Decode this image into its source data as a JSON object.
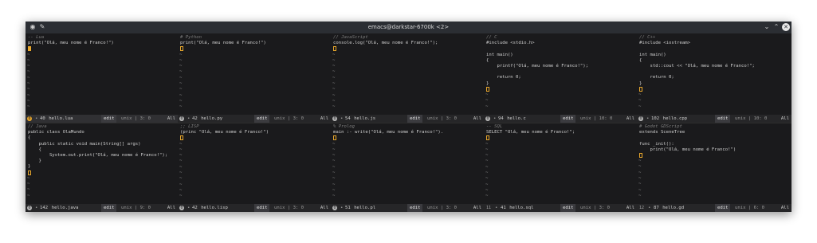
{
  "window": {
    "title": "emacs@darkstar-6700k <2>",
    "app_icon": "emacs-icon",
    "pin_icon": "pin-icon",
    "controls": {
      "minimize": "⌄",
      "maximize": "⌃",
      "close": "✕"
    }
  },
  "accent_color": "#e8a72c",
  "panes": [
    {
      "lines": [
        "-- Lua",
        "print(\"Olá, meu nome é Franco!\")"
      ],
      "modeline": {
        "win": "0",
        "dot": "•",
        "size": "40",
        "buffer": "hello.lua",
        "mode": "edit",
        "enc": "unix | 3: 0",
        "pos": "All"
      }
    },
    {
      "lines": [
        "# Python",
        "print(\"Olá, meu nome é Franco!\")"
      ],
      "modeline": {
        "win": "0",
        "dot": "•",
        "size": "42",
        "buffer": "hello.py",
        "mode": "edit",
        "enc": "unix | 3: 0",
        "pos": "All"
      }
    },
    {
      "lines": [
        "// JavaScript",
        "console.log(\"Olá, meu nome é Franco!\");"
      ],
      "modeline": {
        "win": "0",
        "dot": "•",
        "size": "54",
        "buffer": "hello.js",
        "mode": "edit",
        "enc": "unix | 3: 0",
        "pos": "All"
      }
    },
    {
      "lines": [
        "// C",
        "#include <stdio.h>",
        "",
        "int main()",
        "{",
        "    printf(\"Olá, meu nome é Franco!\");",
        "",
        "    return 0;",
        "}"
      ],
      "modeline": {
        "win": "0",
        "dot": "•",
        "size": "94",
        "buffer": "hello.c",
        "mode": "edit",
        "enc": "unix | 10: 0",
        "pos": "All"
      }
    },
    {
      "lines": [
        "// C++",
        "#include <iostream>",
        "",
        "int main()",
        "{",
        "    std::cout << \"Olá, meu nome é Franco!\";",
        "",
        "    return 0;",
        "}"
      ],
      "modeline": {
        "win": "0",
        "dot": "•",
        "size": "102",
        "buffer": "hello.cpp",
        "mode": "edit",
        "enc": "unix | 10: 0",
        "pos": "All"
      }
    },
    {
      "lines": [
        "// Java",
        "public class OlaMundo",
        "{",
        "    public static void main(String[] args)",
        "    {",
        "        System.out.print(\"Olá, meu nome é Franco!\");",
        "    }",
        "}"
      ],
      "modeline": {
        "win": "0",
        "dot": "•",
        "size": "142",
        "buffer": "hello.java",
        "mode": "edit",
        "enc": "unix | 9: 0",
        "pos": "All"
      }
    },
    {
      "lines": [
        ";; LISP",
        "(princ \"Olá, meu nome é Franco!\")"
      ],
      "modeline": {
        "win": "0",
        "dot": "•",
        "size": "42",
        "buffer": "hello.lisp",
        "mode": "edit",
        "enc": "unix | 3: 0",
        "pos": "All"
      }
    },
    {
      "lines": [
        "% Prolog",
        "main :- write(\"Olá, meu nome é Franco!\")."
      ],
      "modeline": {
        "win": "0",
        "dot": "•",
        "size": "51",
        "buffer": "hello.pl",
        "mode": "edit",
        "enc": "unix | 3: 0",
        "pos": "All"
      }
    },
    {
      "lines": [
        "-- SQL",
        "SELECT \"Olá, meu nome é Franco!\";"
      ],
      "modeline": {
        "win": "11",
        "dot": "•",
        "size": "41",
        "buffer": "hello.sql",
        "mode": "edit",
        "enc": "unix | 3: 0",
        "pos": "All"
      }
    },
    {
      "lines": [
        "# Godot GDScript",
        "extends SceneTree",
        "",
        "func _init():",
        "    print(\"Olá, meu nome é Franco!\")"
      ],
      "modeline": {
        "win": "12",
        "dot": "•",
        "size": "87",
        "buffer": "hello.gd",
        "mode": "edit",
        "enc": "unix | 6: 0",
        "pos": "All"
      }
    }
  ]
}
